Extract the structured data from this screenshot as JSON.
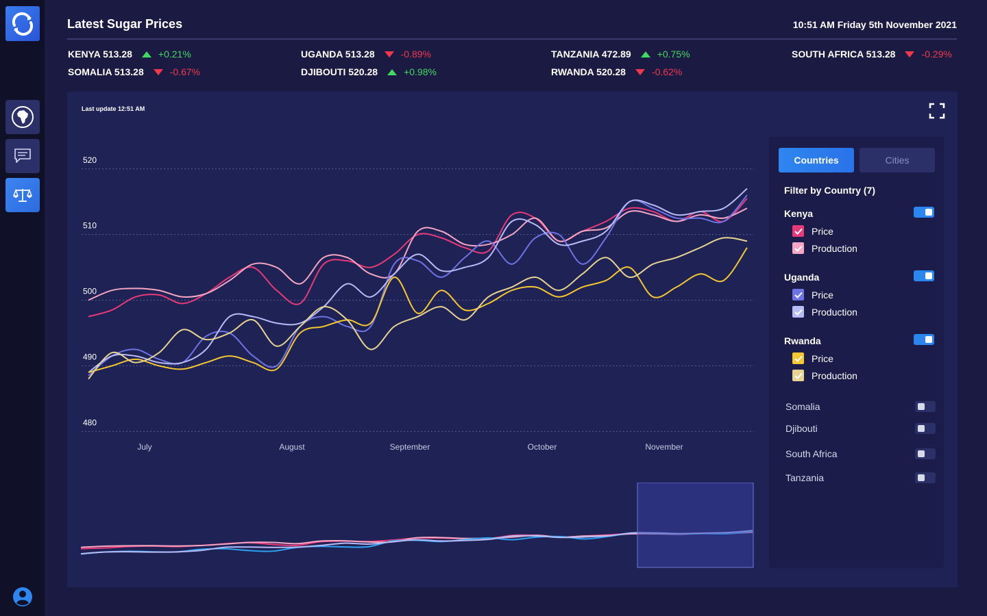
{
  "app": {
    "title": "Latest Sugar Prices",
    "datetime": "10:51 AM Friday 5th November 2021"
  },
  "sidebar": {
    "items": [
      {
        "name": "logo",
        "icon": "sync-icon"
      },
      {
        "name": "map",
        "icon": "africa-globe-icon"
      },
      {
        "name": "messages",
        "icon": "chat-icon"
      },
      {
        "name": "compare",
        "icon": "scales-icon",
        "active": true
      }
    ],
    "user_icon": "user-icon"
  },
  "tickers": [
    {
      "label": "KENYA 513.28",
      "change": "+0.21%",
      "direction": "up"
    },
    {
      "label": "UGANDA 513.28",
      "change": "-0.89%",
      "direction": "down"
    },
    {
      "label": "TANZANIA 472.89",
      "change": "+0.75%",
      "direction": "up"
    },
    {
      "label": "SOUTH AFRICA 513.28",
      "change": "-0.29%",
      "direction": "down"
    },
    {
      "label": "SOMALIA 513.28",
      "change": "-0.67%",
      "direction": "down"
    },
    {
      "label": "DJIBOUTI 520.28",
      "change": "+0.98%",
      "direction": "up"
    },
    {
      "label": "RWANDA 520.28",
      "change": "-0.62%",
      "direction": "down"
    }
  ],
  "panel": {
    "last_update": "Last update 12:51 AM"
  },
  "filter": {
    "tabs": [
      "Countries",
      "Cities"
    ],
    "title": "Filter by Country (7)",
    "active_countries": [
      {
        "name": "Kenya",
        "price_label": "Price",
        "production_label": "Production",
        "price_color": "#e83a79",
        "production_color": "#f4a6c4"
      },
      {
        "name": "Uganda",
        "price_label": "Price",
        "production_label": "Production",
        "price_color": "#6e73e6",
        "production_color": "#b7bbf6"
      },
      {
        "name": "Rwanda",
        "price_label": "Price",
        "production_label": "Production",
        "price_color": "#f5c731",
        "production_color": "#e7d492"
      }
    ],
    "inactive_countries": [
      "Somalia",
      "Djibouti",
      "South Africa",
      "Tanzania"
    ]
  },
  "chart_data": {
    "type": "line",
    "title": "",
    "xlabel": "",
    "ylabel": "",
    "x_ticks": [
      "July",
      "August",
      "September",
      "October",
      "November"
    ],
    "y_ticks": [
      480,
      490,
      500,
      510,
      520
    ],
    "ylim": [
      479,
      523
    ],
    "grid": true,
    "legend": "none",
    "x": [
      0,
      1,
      2,
      3,
      4,
      5,
      6,
      7,
      8,
      9,
      10,
      11,
      12,
      13,
      14,
      15,
      16,
      17,
      18,
      19,
      20,
      21,
      22,
      23,
      24,
      25,
      26,
      27,
      28
    ],
    "series": [
      {
        "name": "Kenya Price",
        "color": "#e83a79",
        "values": [
          497.5,
          498.5,
          500.5,
          500.8,
          499.5,
          501.0,
          503.5,
          505.0,
          501.5,
          499.5,
          505.5,
          506.0,
          505.0,
          507.0,
          510.0,
          509.5,
          508.0,
          507.5,
          513.0,
          512.5,
          509.0,
          510.5,
          512.0,
          514.0,
          513.5,
          512.0,
          513.5,
          512.0,
          515.5
        ]
      },
      {
        "name": "Kenya Production",
        "color": "#f4a6c4",
        "values": [
          500.0,
          501.5,
          501.8,
          501.5,
          500.5,
          501.0,
          503.0,
          505.5,
          505.0,
          502.5,
          506.5,
          506.5,
          504.0,
          504.0,
          510.5,
          510.5,
          508.5,
          508.5,
          510.0,
          512.5,
          509.0,
          510.5,
          511.0,
          513.5,
          513.0,
          512.0,
          513.0,
          512.5,
          514.0
        ]
      },
      {
        "name": "Uganda Price",
        "color": "#6e73e6",
        "values": [
          488.5,
          491.5,
          492.5,
          491.0,
          490.5,
          494.5,
          495.0,
          491.5,
          490.0,
          496.0,
          497.5,
          496.0,
          496.0,
          505.5,
          506.0,
          503.5,
          506.5,
          509.0,
          505.5,
          509.5,
          510.0,
          505.5,
          509.5,
          515.0,
          514.0,
          512.5,
          512.5,
          512.0,
          516.0
        ]
      },
      {
        "name": "Uganda Production",
        "color": "#b7bbf6",
        "values": [
          489.0,
          491.5,
          491.5,
          490.5,
          490.5,
          492.5,
          497.5,
          497.5,
          496.5,
          496.5,
          499.0,
          502.5,
          500.5,
          504.0,
          507.0,
          504.5,
          505.0,
          506.5,
          512.0,
          511.5,
          508.5,
          509.0,
          510.5,
          515.0,
          514.5,
          513.0,
          513.5,
          514.0,
          517.0
        ]
      },
      {
        "name": "Rwanda Price",
        "color": "#f5c731",
        "values": [
          489.0,
          490.0,
          491.0,
          490.0,
          489.5,
          490.5,
          491.5,
          490.5,
          489.5,
          495.0,
          496.0,
          497.0,
          496.5,
          503.5,
          498.0,
          501.5,
          498.5,
          499.5,
          501.5,
          502.0,
          500.5,
          502.0,
          503.0,
          505.0,
          500.5,
          502.0,
          504.0,
          503.0,
          508.0
        ]
      },
      {
        "name": "Rwanda Production",
        "color": "#e7d492",
        "values": [
          488.0,
          492.0,
          490.5,
          492.0,
          495.5,
          494.0,
          495.0,
          497.0,
          493.0,
          496.0,
          499.0,
          497.0,
          492.5,
          496.0,
          497.5,
          499.0,
          497.0,
          500.5,
          502.0,
          503.5,
          501.5,
          504.0,
          506.5,
          503.5,
          505.5,
          506.5,
          508.0,
          509.5,
          509.0
        ]
      }
    ]
  }
}
